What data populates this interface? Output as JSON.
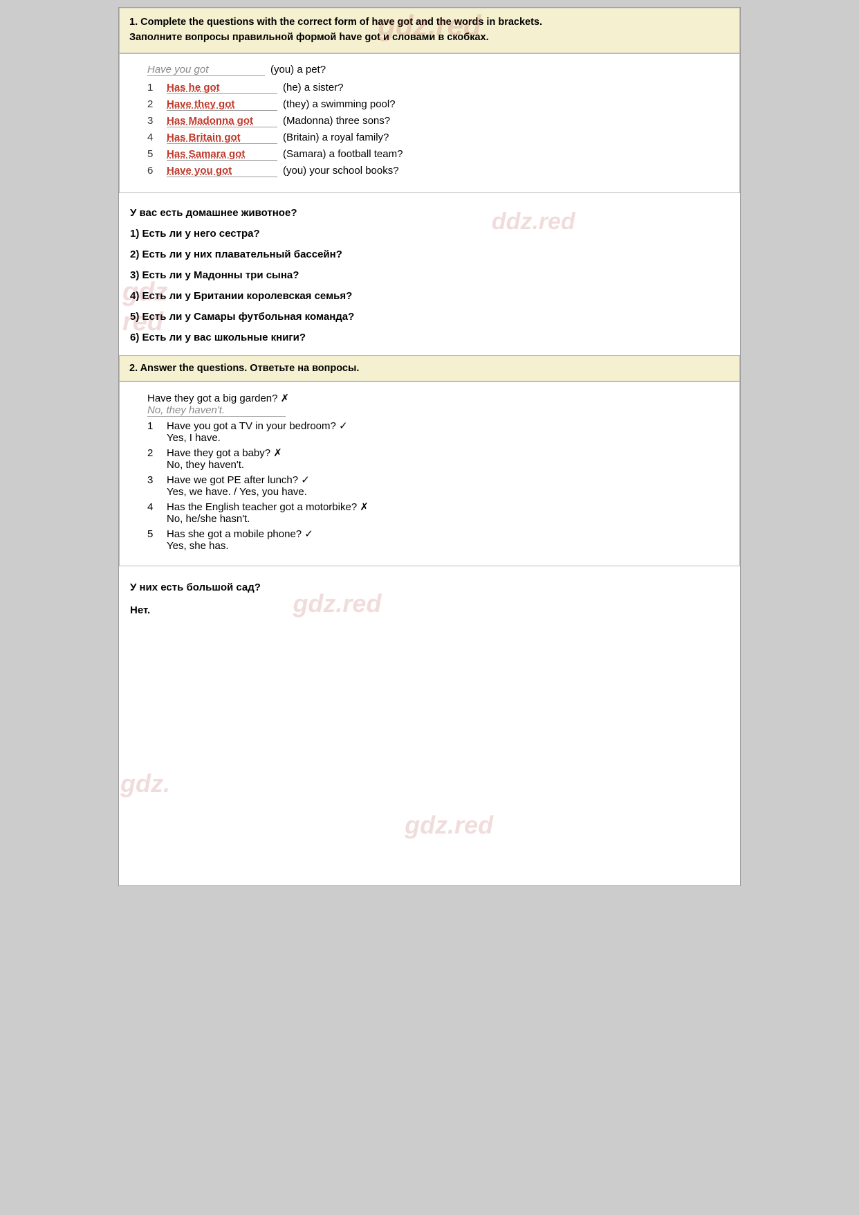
{
  "watermarks": [
    "gdz.red",
    "ddz.red",
    "gdz red",
    "gdz.red",
    "gdz.red",
    "gdz red"
  ],
  "section1": {
    "header_en": "1. Complete the questions with the correct form of have got  and the words in brackets.",
    "header_ru": "Заполните вопросы правильной формой have got и словами в скобках.",
    "example": {
      "answer": "Have you got",
      "question": "(you) a pet?"
    },
    "rows": [
      {
        "num": "1",
        "answer": "Has he got",
        "question": "(he) a sister?"
      },
      {
        "num": "2",
        "answer": "Have they got",
        "question": "(they) a swimming pool?"
      },
      {
        "num": "3",
        "answer": "Has Madonna got",
        "question": "(Madonna) three sons?"
      },
      {
        "num": "4",
        "answer": "Has Britain got",
        "question": "(Britain) a royal family?"
      },
      {
        "num": "5",
        "answer": "Has Samara got",
        "question": "(Samara) a football team?"
      },
      {
        "num": "6",
        "answer": "Have you got",
        "question": "(you) your school books?"
      }
    ],
    "translations": [
      "У вас есть домашнее животное?",
      "1) Есть ли у него сестра?",
      "2) Есть ли у них плавательный бассейн?",
      "3) Есть ли у Мадонны три сына?",
      "4) Есть ли у Британии королевская семья?",
      "5) Есть ли у Самары футбольная команда?",
      "6) Есть ли у вас школьные книги?"
    ]
  },
  "section2": {
    "header_en": "2. Answer the questions. Ответьте на вопросы.",
    "example": {
      "question": "Have they got a big garden? ✗",
      "answer": "No, they haven't."
    },
    "rows": [
      {
        "num": "1",
        "question": "Have you got a TV in your bedroom? ✓",
        "answer": "Yes, I have."
      },
      {
        "num": "2",
        "question": "Have they got a baby? ✗",
        "answer": "No, they haven't."
      },
      {
        "num": "3",
        "question": "Have we got PE after lunch? ✓",
        "answer": "Yes, we have. / Yes, you have."
      },
      {
        "num": "4",
        "question": "Has the English teacher got a motorbike? ✗",
        "answer": "No, he/she hasn't."
      },
      {
        "num": "5",
        "question": "Has she got a mobile phone? ✓",
        "answer": "Yes, she has."
      }
    ],
    "translations": [
      "У них есть большой сад?",
      "Нет."
    ]
  }
}
